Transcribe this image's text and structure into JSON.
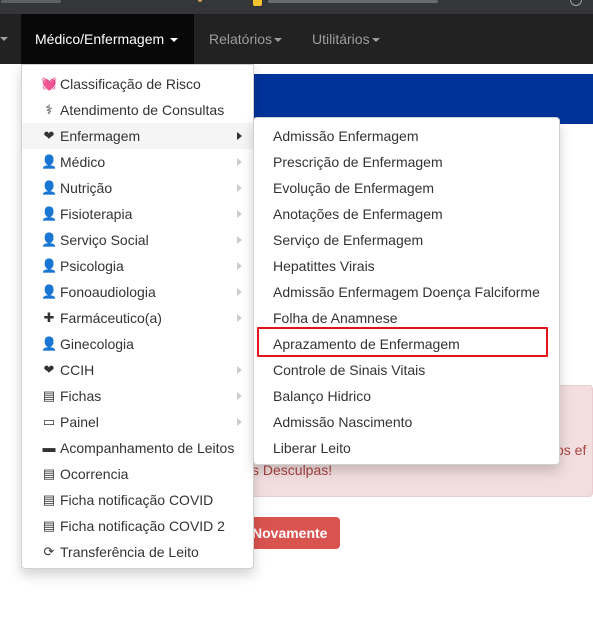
{
  "navbar": {
    "items": [
      {
        "label": "Médico/Enfermagem",
        "active": true
      },
      {
        "label": "Relatórios",
        "active": false
      },
      {
        "label": "Utilitários",
        "active": false
      }
    ]
  },
  "dropdown": {
    "items": [
      {
        "label": "Classificação de Risco",
        "icon": "heartbeat-icon",
        "glyph": "💓",
        "submenu": false
      },
      {
        "label": "Atendimento de Consultas",
        "icon": "stethoscope-icon",
        "glyph": "⚕",
        "submenu": false
      },
      {
        "label": "Enfermagem",
        "icon": "heart-icon",
        "glyph": "❤",
        "submenu": true,
        "hover": true
      },
      {
        "label": "Médico",
        "icon": "user-md-icon",
        "glyph": "👤",
        "submenu": true
      },
      {
        "label": "Nutrição",
        "icon": "user-md-icon",
        "glyph": "👤",
        "submenu": true
      },
      {
        "label": "Fisioterapia",
        "icon": "user-md-icon",
        "glyph": "👤",
        "submenu": true
      },
      {
        "label": "Serviço Social",
        "icon": "user-md-icon",
        "glyph": "👤",
        "submenu": true
      },
      {
        "label": "Psicologia",
        "icon": "user-md-icon",
        "glyph": "👤",
        "submenu": true
      },
      {
        "label": "Fonoaudiologia",
        "icon": "user-md-icon",
        "glyph": "👤",
        "submenu": true
      },
      {
        "label": "Farmáceutico(a)",
        "icon": "medkit-icon",
        "glyph": "✚",
        "submenu": true
      },
      {
        "label": "Ginecologia",
        "icon": "user-md-icon",
        "glyph": "👤",
        "submenu": false
      },
      {
        "label": "CCIH",
        "icon": "heart-icon",
        "glyph": "❤",
        "submenu": true
      },
      {
        "label": "Fichas",
        "icon": "list-alt-icon",
        "glyph": "▤",
        "submenu": true
      },
      {
        "label": "Painel",
        "icon": "desktop-icon",
        "glyph": "▭",
        "submenu": true
      },
      {
        "label": "Acompanhamento de Leitos",
        "icon": "bed-icon",
        "glyph": "▬",
        "submenu": false
      },
      {
        "label": "Ocorrencia",
        "icon": "list-alt-icon",
        "glyph": "▤",
        "submenu": false
      },
      {
        "label": "Ficha notificação COVID",
        "icon": "list-alt-icon",
        "glyph": "▤",
        "submenu": false
      },
      {
        "label": "Ficha notificação COVID 2",
        "icon": "list-alt-icon",
        "glyph": "▤",
        "submenu": false
      },
      {
        "label": "Transferência de Leito",
        "icon": "refresh-icon",
        "glyph": "⟳",
        "submenu": false
      }
    ]
  },
  "submenu": {
    "items": [
      {
        "label": "Admissão Enfermagem"
      },
      {
        "label": "Prescrição de Enfermagem"
      },
      {
        "label": "Evolução de Enfermagem"
      },
      {
        "label": "Anotações de Enfermagem"
      },
      {
        "label": "Serviço de Enfermagem"
      },
      {
        "label": "Hepatittes Virais"
      },
      {
        "label": "Admissão Enfermagem Doença Falciforme"
      },
      {
        "label": "Folha de Anamnese"
      },
      {
        "label": "Aprazamento de Enfermagem",
        "highlighted": true
      },
      {
        "label": "Controle de Sinais Vitais"
      },
      {
        "label": "Balanço Hidrico"
      },
      {
        "label": "Admissão Nascimento"
      },
      {
        "label": "Liberar Leito"
      }
    ]
  },
  "alert": {
    "text_right": "os ef",
    "text_second": "s Desculpas!"
  },
  "retry_button": {
    "label": "Novamente"
  },
  "colors": {
    "navbar": "#222222",
    "navbar_active": "#080808",
    "banner": "#003399",
    "alert_bg": "#f2dede",
    "alert_text": "#a94442",
    "button": "#d9534f",
    "highlight": "#e3121b"
  }
}
